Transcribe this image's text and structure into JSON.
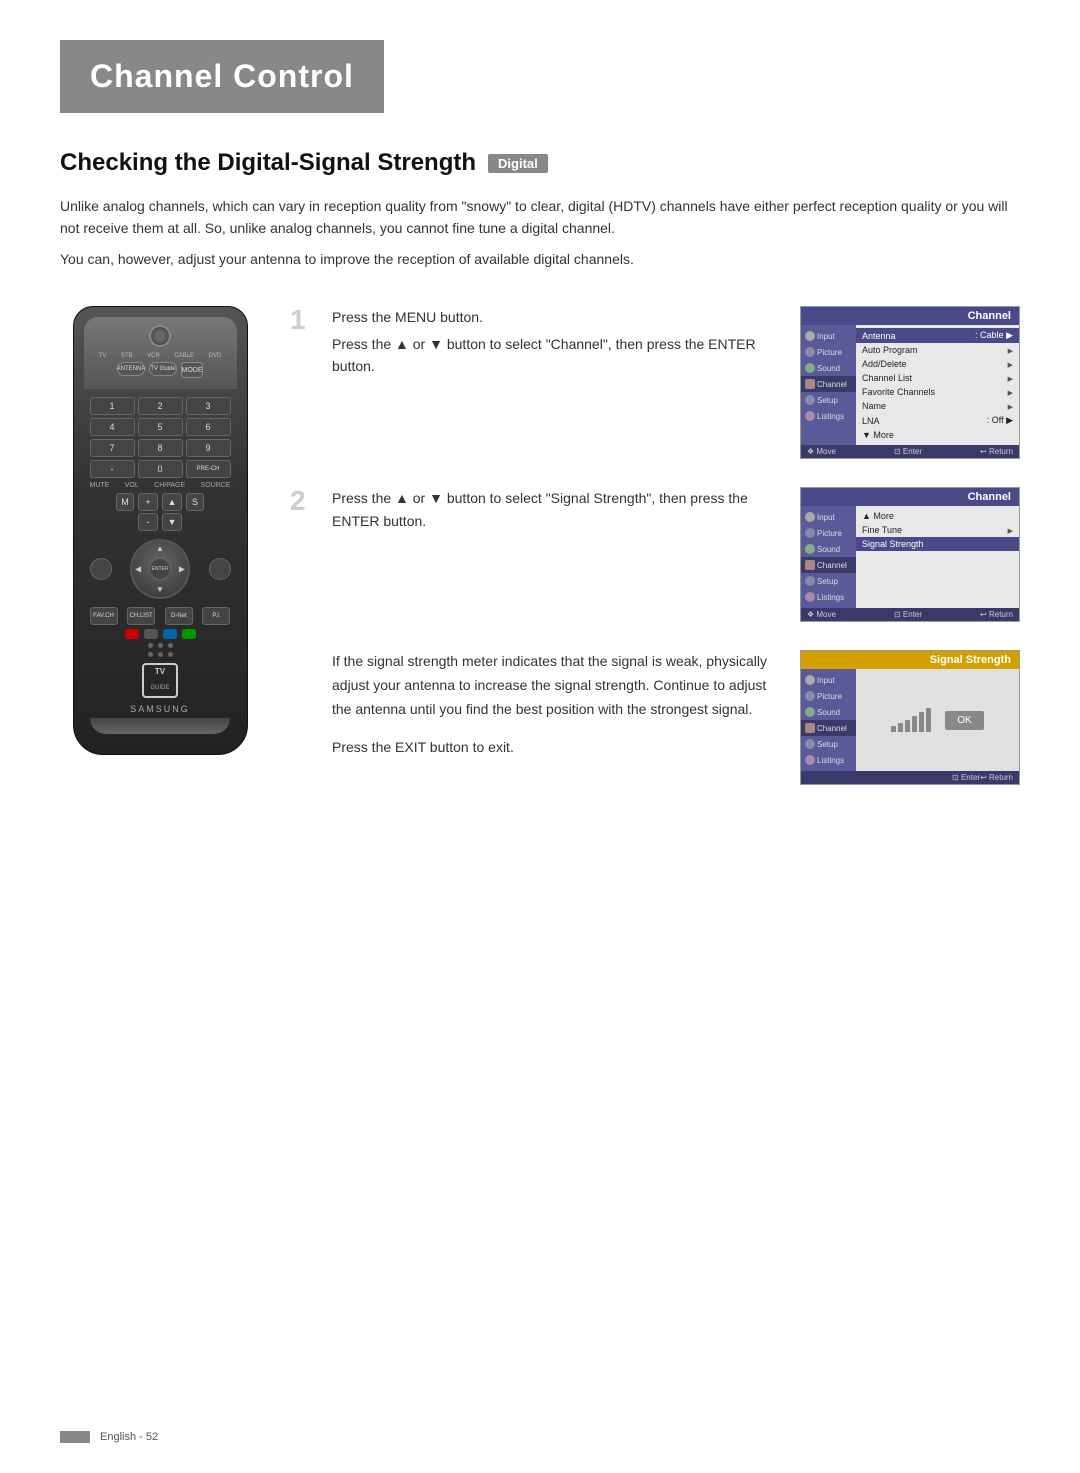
{
  "page": {
    "title": "Channel Control",
    "section_title": "Checking the Digital-Signal Strength",
    "badge": "Digital",
    "description1": "Unlike analog channels, which can vary in reception quality from \"snowy\" to clear, digital (HDTV) channels have either perfect reception quality or you will not receive them at all. So, unlike analog channels, you cannot fine tune a digital channel.",
    "description2": "You can, however, adjust your antenna to improve the reception of available digital channels."
  },
  "steps": {
    "step1": {
      "number": "1",
      "text1": "Press the MENU button.",
      "text2": "Press the ▲ or ▼ button to select \"Channel\", then press the ENTER button."
    },
    "step2": {
      "number": "2",
      "text1": "Press the ▲ or ▼ button to select \"Signal Strength\", then press the ENTER button."
    },
    "step3": {
      "text1": "If the signal strength meter indicates that the signal is weak, physically adjust your antenna to increase the signal strength. Continue to adjust the antenna until you find the best position with the strongest signal."
    },
    "exit_text": "Press the EXIT button to exit."
  },
  "menu1": {
    "header": "Channel",
    "sidebar_items": [
      "Input",
      "Picture",
      "Sound",
      "Channel",
      "Setup",
      "Listings"
    ],
    "items": [
      {
        "label": "Antenna",
        "value": ": Cable",
        "arrow": true
      },
      {
        "label": "Auto Program",
        "arrow": true
      },
      {
        "label": "Add/Delete",
        "arrow": true
      },
      {
        "label": "Channel List",
        "arrow": true
      },
      {
        "label": "Favorite Channels",
        "arrow": true
      },
      {
        "label": "Name",
        "arrow": true
      },
      {
        "label": "LNA",
        "value": ": Off",
        "arrow": true
      },
      {
        "label": "▼ More"
      }
    ],
    "footer_move": "❖ Move",
    "footer_enter": "⊡ Enter",
    "footer_return": "↩ Return"
  },
  "menu2": {
    "header": "Channel",
    "sidebar_items": [
      "Input",
      "Picture",
      "Sound",
      "Channel",
      "Setup",
      "Listings"
    ],
    "items": [
      {
        "label": "▲ More"
      },
      {
        "label": "Fine Tune",
        "arrow": true
      },
      {
        "label": "Signal Strength",
        "arrow": true,
        "highlighted": true
      }
    ],
    "footer_move": "❖ Move",
    "footer_enter": "⊡ Enter",
    "footer_return": "↩ Return"
  },
  "signal": {
    "header": "Signal Strength",
    "sidebar_items": [
      "Input",
      "Picture",
      "Sound",
      "Channel",
      "Setup",
      "Listings"
    ],
    "ok_label": "OK",
    "footer_enter": "⊡ Enter",
    "footer_return": "↩ Return"
  },
  "footer": {
    "text": "English - 52"
  },
  "remote": {
    "brand": "SAMSUNG",
    "power_label": "POWER",
    "buttons": {
      "top_labels": [
        "TV",
        "STB",
        "VCR",
        "CABLE",
        "DVD"
      ],
      "mode": "MODE",
      "antenna": "ANTENNA",
      "tv_guide": "TV Guide",
      "numbers": [
        "1",
        "2",
        "3",
        "4",
        "5",
        "6",
        "7",
        "8",
        "9",
        "-",
        "0",
        "PRE-CH"
      ],
      "mute": "MUTE",
      "vol": "VOL",
      "ch": "CH/PAGE",
      "source": "SOURCE",
      "nav_center": "ENTER",
      "colors": [
        "#c00",
        "#555",
        "#06a",
        "#090"
      ],
      "bottom_labels": [
        "FAV.CH",
        "CH.LIST",
        "D-Net",
        "P.I."
      ]
    }
  }
}
